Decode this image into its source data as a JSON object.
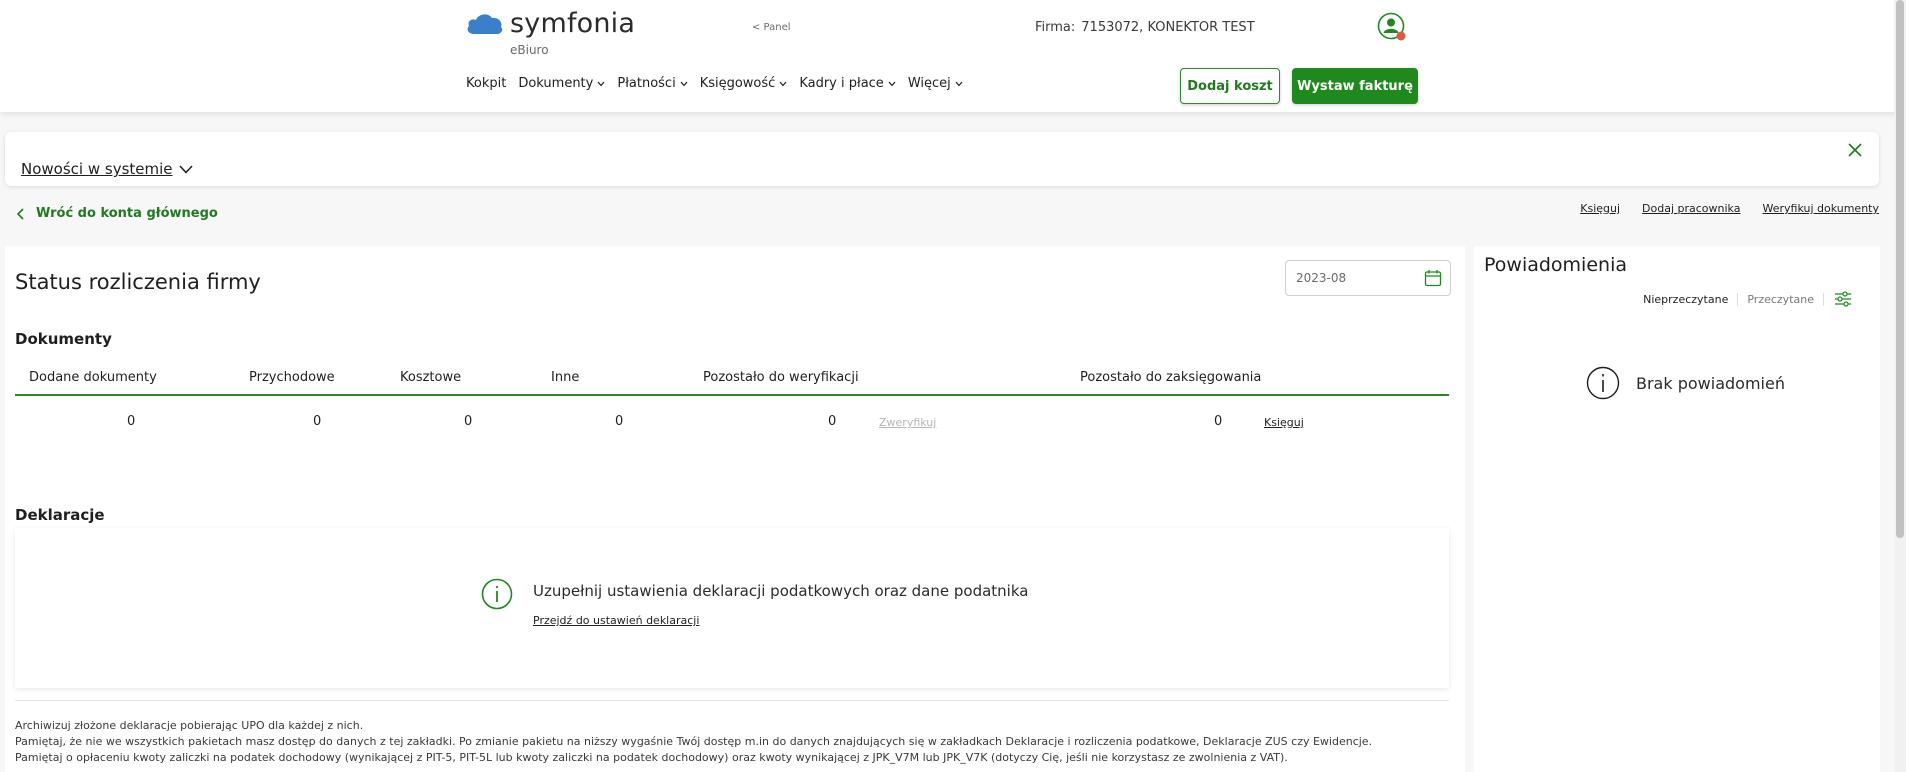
{
  "header": {
    "logo_text": "symfonia",
    "logo_sub": "eBiuro",
    "panel_link": "< Panel",
    "firm_label": "Firma:",
    "firm_value": "7153072, KONEKTOR TEST",
    "nav": [
      "Kokpit",
      "Dokumenty",
      "Płatności",
      "Księgowość",
      "Kadry i płace",
      "Więcej"
    ],
    "btn_add_cost": "Dodaj koszt",
    "btn_issue_invoice": "Wystaw fakturę"
  },
  "news": {
    "label": "Nowości w systemie"
  },
  "back_link": "Wróć do konta głównego",
  "top_links": [
    "Księguj",
    "Dodaj pracownika",
    "Weryfikuj dokumenty"
  ],
  "status": {
    "title": "Status rozliczenia firmy",
    "date": "2023-08",
    "documents_title": "Dokumenty",
    "columns": [
      "Dodane dokumenty",
      "Przychodowe",
      "Kosztowe",
      "Inne",
      "Pozostało do weryfikacji",
      "Pozostało do zaksięgowania"
    ],
    "values": [
      "0",
      "0",
      "0",
      "0",
      "0",
      "0"
    ],
    "verify_link": "Zweryfikuj",
    "book_link": "Księguj",
    "declarations_title": "Deklaracje",
    "decl_message": "Uzupełnij ustawienia deklaracji podatkowych oraz dane podatnika",
    "decl_link": "Przejdź do ustawień deklaracji",
    "notes": [
      "Archiwizuj złożone deklaracje pobierając UPO dla każdej z nich.",
      "Pamiętaj, że nie we wszystkich pakietach masz dostęp do danych z tej zakładki. Po zmianie pakietu na niższy wygaśnie Twój dostęp m.in do danych znajdujących się w zakładkach Deklaracje i rozliczenia podatkowe, Deklaracje ZUS czy Ewidencje.",
      "Pamiętaj o opłaceniu kwoty zaliczki na podatek dochodowy (wynikającej z PIT-5, PIT-5L lub kwoty zaliczki na podatek dochodowy) oraz kwoty wynikającej z JPK_V7M lub JPK_V7K (dotyczy Cię, jeśli nie korzystasz ze zwolnienia z VAT)."
    ]
  },
  "notifications": {
    "title": "Powiadomienia",
    "tab_unread": "Nieprzeczytane",
    "tab_read": "Przeczytane",
    "empty": "Brak powiadomień"
  },
  "colors": {
    "accent": "#1e8a1e",
    "accent_dark": "#1e7b1e",
    "logo_blue": "#3a7fc9"
  },
  "icons": [
    "cloud-logo-icon",
    "user-icon",
    "chevron-down-icon",
    "close-icon",
    "chevron-left-icon",
    "calendar-icon",
    "info-icon",
    "filter-icon"
  ]
}
